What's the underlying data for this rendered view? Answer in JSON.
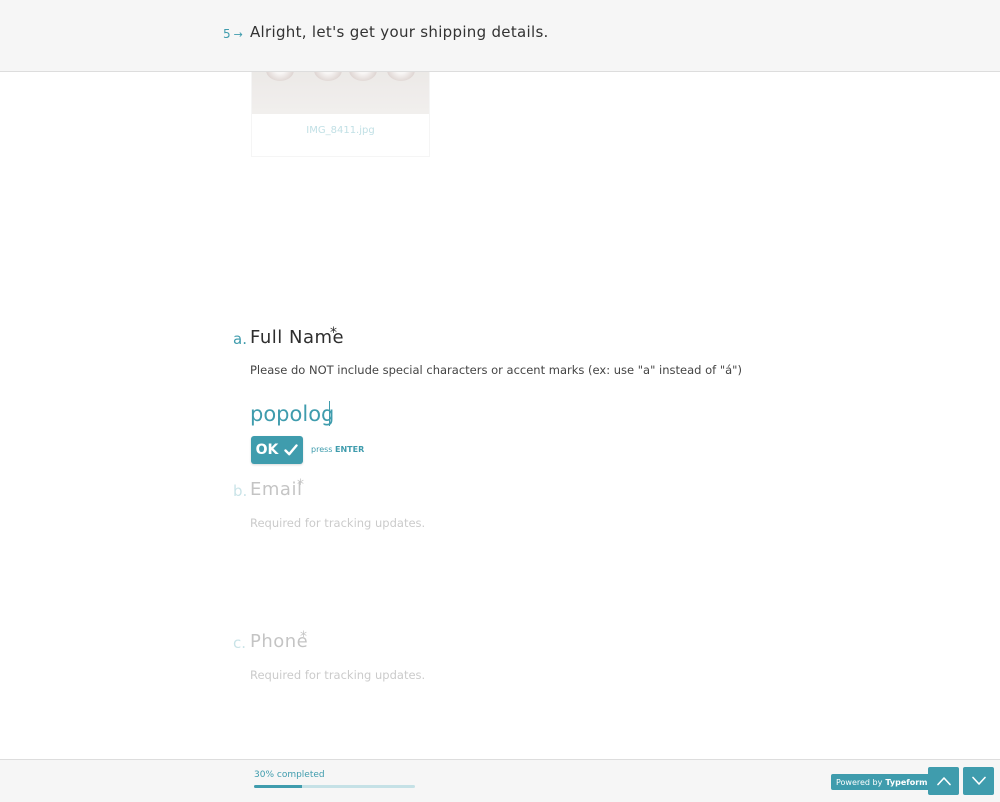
{
  "header": {
    "question_number": "5",
    "question_arrow": "→",
    "title": "Alright, let's get your shipping details."
  },
  "image_card": {
    "filename": "IMG_8411.jpg"
  },
  "questions": [
    {
      "letter": "a.",
      "label": "Full Name",
      "required_mark": "*",
      "help": "Please do NOT include special characters or accent marks (ex: use \"a\" instead of \"á\")",
      "answer": "popolog"
    },
    {
      "letter": "b.",
      "label": "Email",
      "required_mark": "*",
      "help": "Required for tracking updates."
    },
    {
      "letter": "c.",
      "label": "Phone",
      "required_mark": "*",
      "help": "Required for tracking updates."
    }
  ],
  "ok_button": {
    "label": "OK",
    "check_icon": "checkmark-icon"
  },
  "press_hint": {
    "prefix": "press",
    "key": "ENTER"
  },
  "footer": {
    "progress_text": "30% completed",
    "progress_fraction": 0.3,
    "powered_prefix": "Powered by",
    "powered_brand": "Typeform",
    "prev_icon": "chevron-up-icon",
    "next_icon": "chevron-down-icon"
  },
  "colors": {
    "accent": "#3f9cad",
    "header_bg": "#f6f6f6",
    "text": "#2e2e2e"
  }
}
